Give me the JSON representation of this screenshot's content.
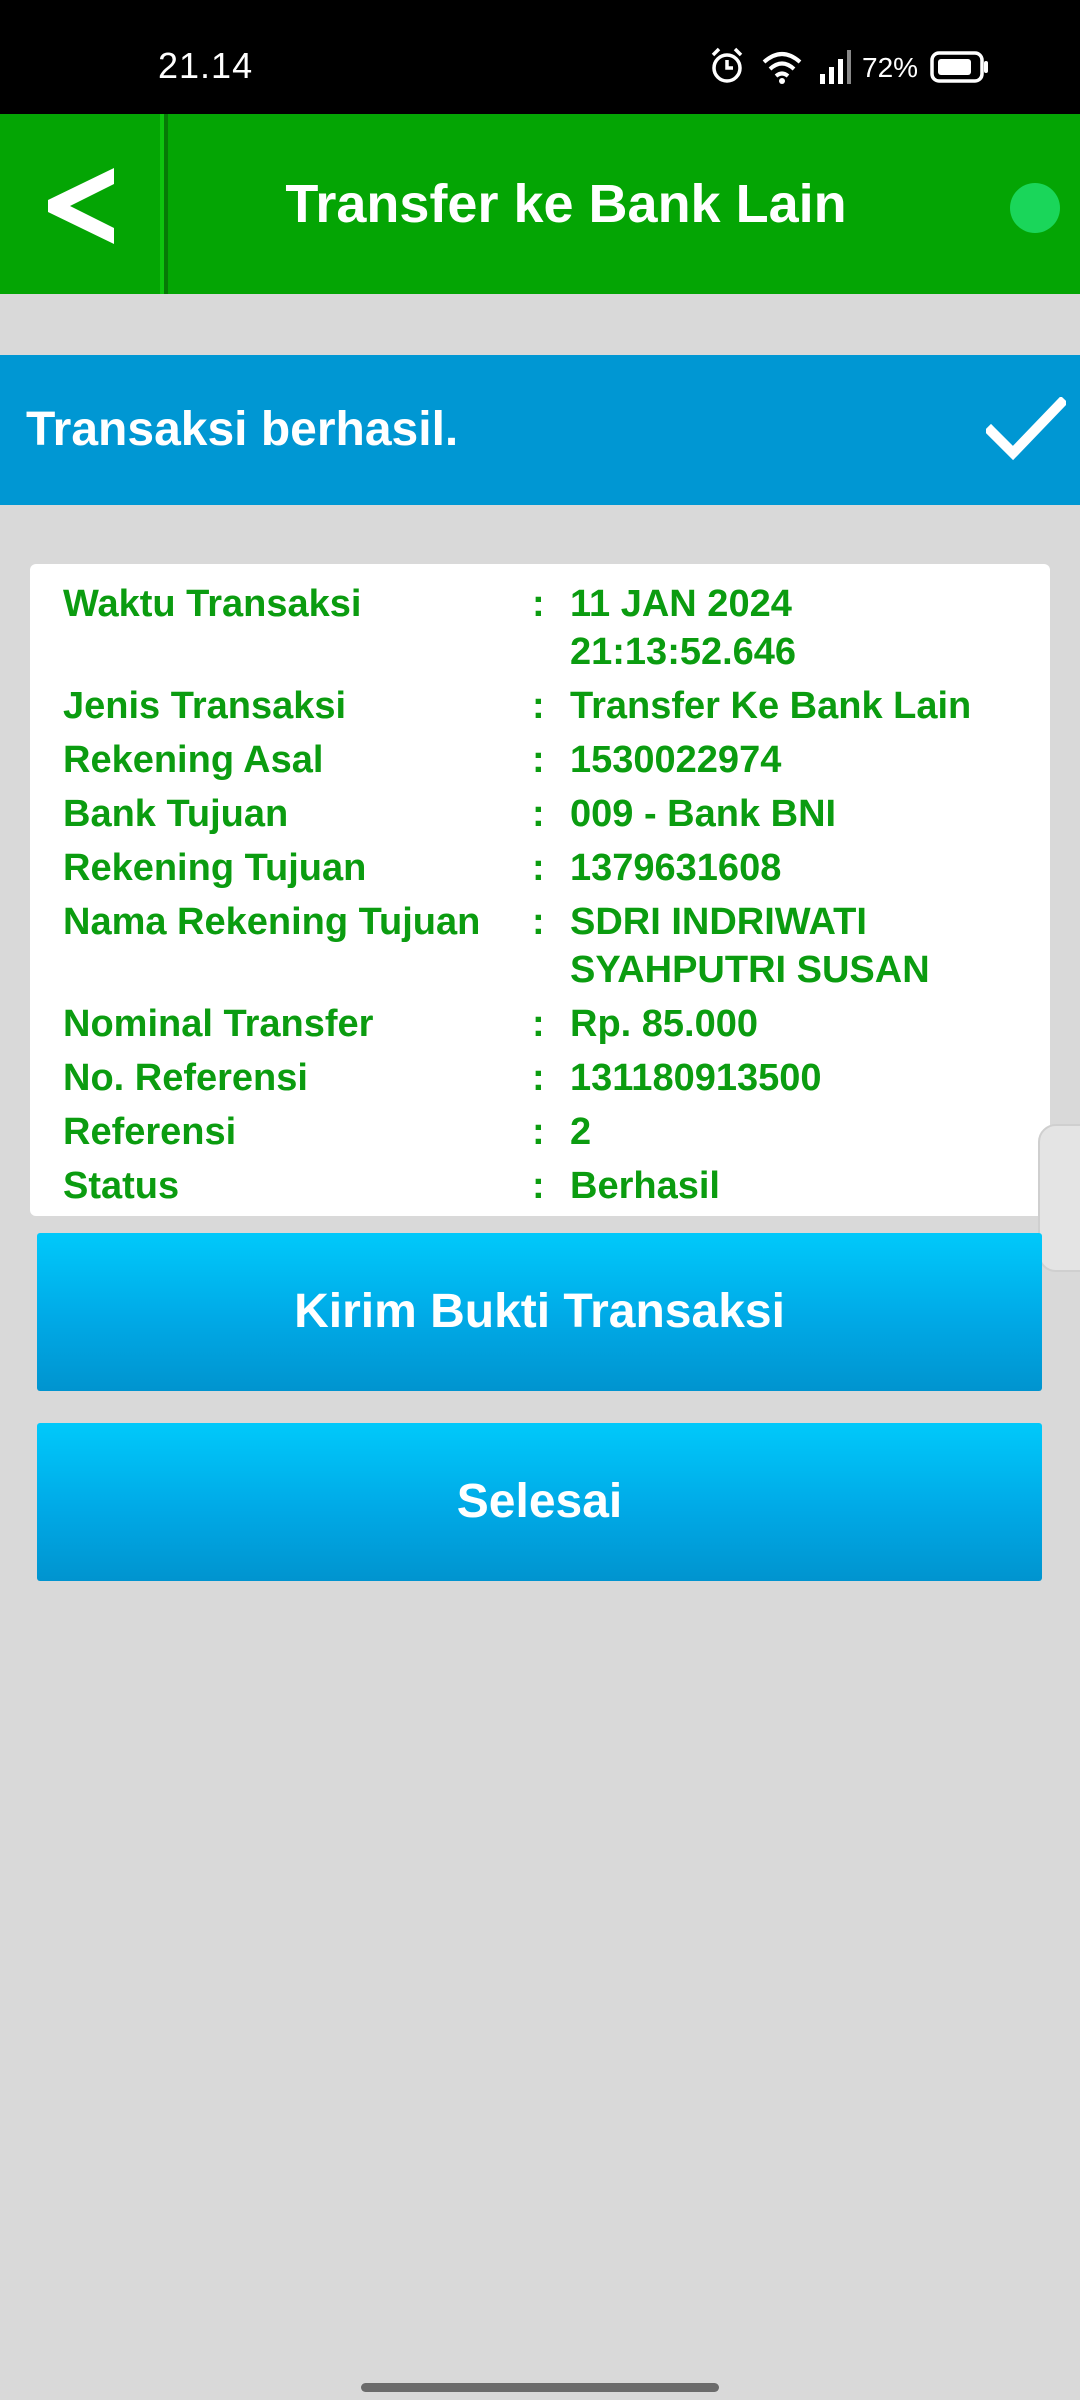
{
  "status_bar": {
    "time": "21.14",
    "battery": "72%",
    "icons": [
      "alarm-icon",
      "wifi-icon",
      "signal-icon",
      "battery-icon"
    ]
  },
  "header": {
    "title": "Transfer ke Bank Lain",
    "back_icon": "chevron-left-icon"
  },
  "banner": {
    "text": "Transaksi berhasil.",
    "icon": "checkmark-icon"
  },
  "details": {
    "separator": ":",
    "rows": [
      {
        "label": "Waktu Transaksi",
        "value": "11 JAN 2024",
        "value2": "21:13:52.646"
      },
      {
        "label": "Jenis Transaksi",
        "value": "Transfer Ke Bank Lain"
      },
      {
        "label": "Rekening Asal",
        "value": "1530022974"
      },
      {
        "label": "Bank Tujuan",
        "value": "009 - Bank BNI"
      },
      {
        "label": "Rekening Tujuan",
        "value": "1379631608"
      },
      {
        "label": "Nama Rekening Tujuan",
        "value": "SDRI INDRIWATI",
        "value2": "SYAHPUTRI SUSAN"
      },
      {
        "label": "Nominal Transfer",
        "value": "Rp. 85.000"
      },
      {
        "label": "No. Referensi",
        "value": "131180913500"
      },
      {
        "label": "Referensi",
        "value": "2"
      },
      {
        "label": "Status",
        "value": "Berhasil"
      }
    ]
  },
  "buttons": {
    "send_proof": "Kirim Bukti Transaksi",
    "done": "Selesai"
  },
  "colors": {
    "header_green": "#04a504",
    "banner_blue": "#0097d3",
    "detail_text_green": "#0b9c10",
    "button_blue": "#00b4ec",
    "background": "#d9d9d9"
  }
}
